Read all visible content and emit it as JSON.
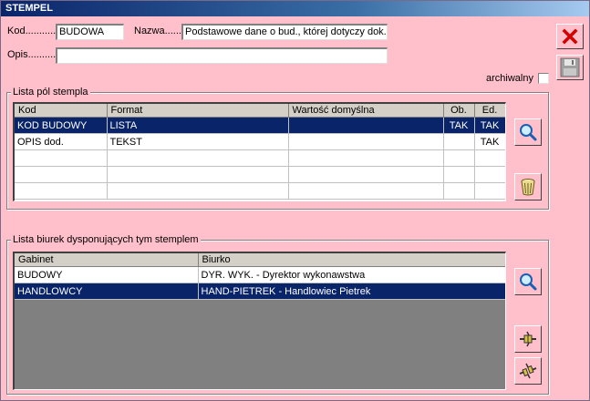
{
  "window": {
    "title": "STEMPEL"
  },
  "header": {
    "kod_label": "Kod...........",
    "kod_value": "BUDOWA",
    "nazwa_label": "Nazwa.......",
    "nazwa_value": "Podstawowe dane o bud., której dotyczy dok.",
    "opis_label": "Opis...........",
    "opis_value": "",
    "archiwalny_label": "archiwalny",
    "archiwalny_checked": false
  },
  "fields_group": {
    "title": "Lista pól stempla",
    "columns": [
      "Kod",
      "Format",
      "Wartość domyślna",
      "Ob.",
      "Ed."
    ],
    "rows": [
      {
        "kod": "KOD BUDOWY",
        "format": "LISTA",
        "wartosc": "",
        "ob": "TAK",
        "ed": "TAK",
        "selected": true
      },
      {
        "kod": "OPIS dod.",
        "format": "TEKST",
        "wartosc": "",
        "ob": "",
        "ed": "TAK",
        "selected": false
      },
      {
        "kod": "",
        "format": "",
        "wartosc": "",
        "ob": "",
        "ed": "",
        "selected": false
      },
      {
        "kod": "",
        "format": "",
        "wartosc": "",
        "ob": "",
        "ed": "",
        "selected": false
      },
      {
        "kod": "",
        "format": "",
        "wartosc": "",
        "ob": "",
        "ed": "",
        "selected": false
      }
    ]
  },
  "offices_group": {
    "title": "Lista biurek dysponujących tym stemplem",
    "columns": [
      "Gabinet",
      "Biurko"
    ],
    "rows": [
      {
        "gabinet": "BUDOWY",
        "biurko": "DYR. WYK. - Dyrektor wykonawstwa",
        "selected": false
      },
      {
        "gabinet": "HANDLOWCY",
        "biurko": "HAND-PIETREK - Handlowiec Pietrek",
        "selected": true
      }
    ]
  },
  "icons": {
    "close": "close-x-icon",
    "save": "floppy-disk-icon",
    "search": "magnifier-icon",
    "delete": "trash-bin-icon",
    "attach": "plug-connect-icon",
    "detach": "plug-disconnect-icon"
  },
  "colors": {
    "background": "#ffc0cb",
    "selection": "#0a246a",
    "close_icon": "#d40000",
    "grid_empty": "#808080"
  }
}
